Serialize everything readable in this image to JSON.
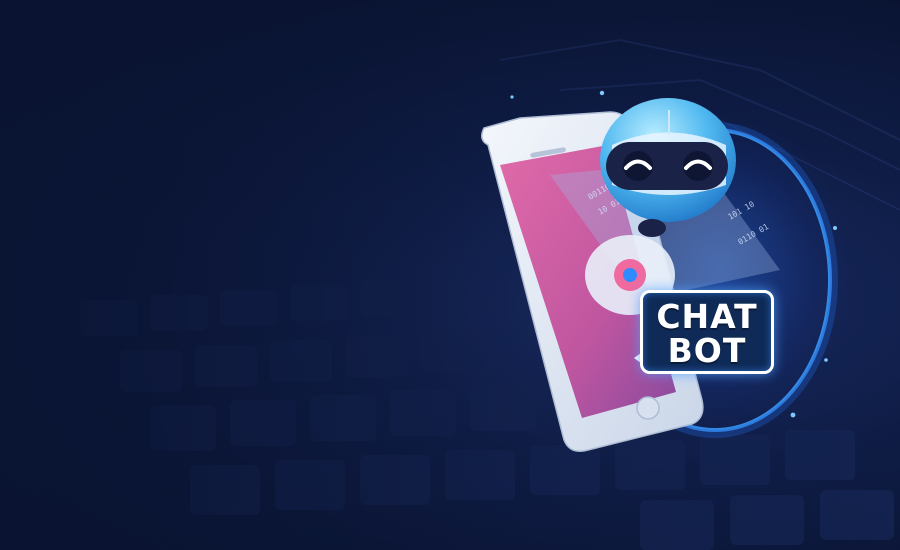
{
  "image": {
    "badge": {
      "line1": "CHAT",
      "line2": "BOT"
    },
    "binary_text": [
      "0011010",
      "10 0110",
      "101 10",
      "0110 01"
    ],
    "colors": {
      "background": "#0b1533",
      "accent_glow": "#2f8bff",
      "phone_body": "#e8eef7",
      "screen": "#c8569a",
      "robot_head": "#4fb8f0",
      "badge_fill": "#0f2a56"
    },
    "icons": [
      "smartphone-icon",
      "robot-head-icon",
      "chat-bubble-icon",
      "keyboard-background"
    ]
  }
}
